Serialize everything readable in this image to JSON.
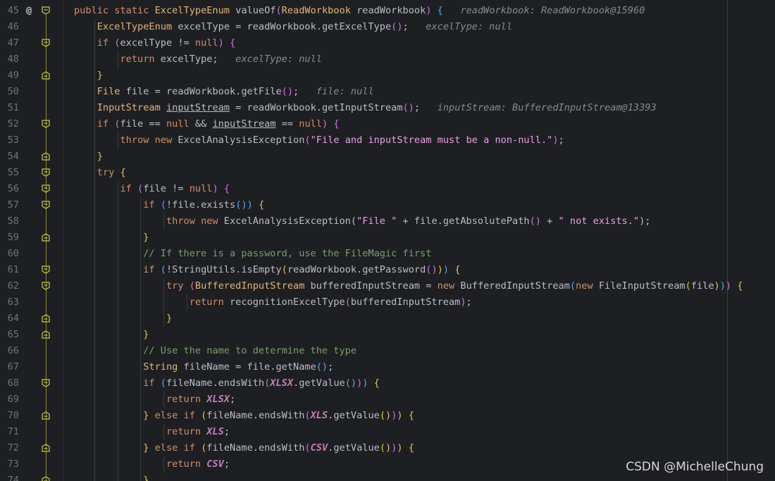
{
  "watermark": "CSDN @MichelleChung",
  "lines": [
    {
      "n": "45",
      "at": "@"
    },
    {
      "n": "46"
    },
    {
      "n": "47"
    },
    {
      "n": "48"
    },
    {
      "n": "49"
    },
    {
      "n": "50"
    },
    {
      "n": "51"
    },
    {
      "n": "52"
    },
    {
      "n": "53"
    },
    {
      "n": "54"
    },
    {
      "n": "55"
    },
    {
      "n": "56"
    },
    {
      "n": "57"
    },
    {
      "n": "58"
    },
    {
      "n": "59"
    },
    {
      "n": "60"
    },
    {
      "n": "61"
    },
    {
      "n": "62"
    },
    {
      "n": "63"
    },
    {
      "n": "64"
    },
    {
      "n": "65"
    },
    {
      "n": "66"
    },
    {
      "n": "67"
    },
    {
      "n": "68"
    },
    {
      "n": "69"
    },
    {
      "n": "70"
    },
    {
      "n": "71"
    },
    {
      "n": "72"
    },
    {
      "n": "73"
    },
    {
      "n": "74"
    }
  ],
  "hints": {
    "l45": "readWorkbook: ReadWorkbook@15960",
    "l46": "excelType: null",
    "l48": "excelType: null",
    "l50": "file: null",
    "l51": "inputStream: BufferedInputStream@13393"
  },
  "strings": {
    "l53": "\"File and inputStream must be a non-null.\"",
    "l58a": "\"File \"",
    "l58b": "\" not exists.\""
  },
  "comments": {
    "l60": "// If there is a password, use the FileMagic first",
    "l66": "// Use the name to determine the type"
  },
  "colors": {
    "background": "#1e1f22",
    "keyword": "#cf8e6d",
    "type": "#e0b57a",
    "comment": "#7a9e6e",
    "string": "#e5a1e8",
    "constant": "#c77dbb"
  }
}
